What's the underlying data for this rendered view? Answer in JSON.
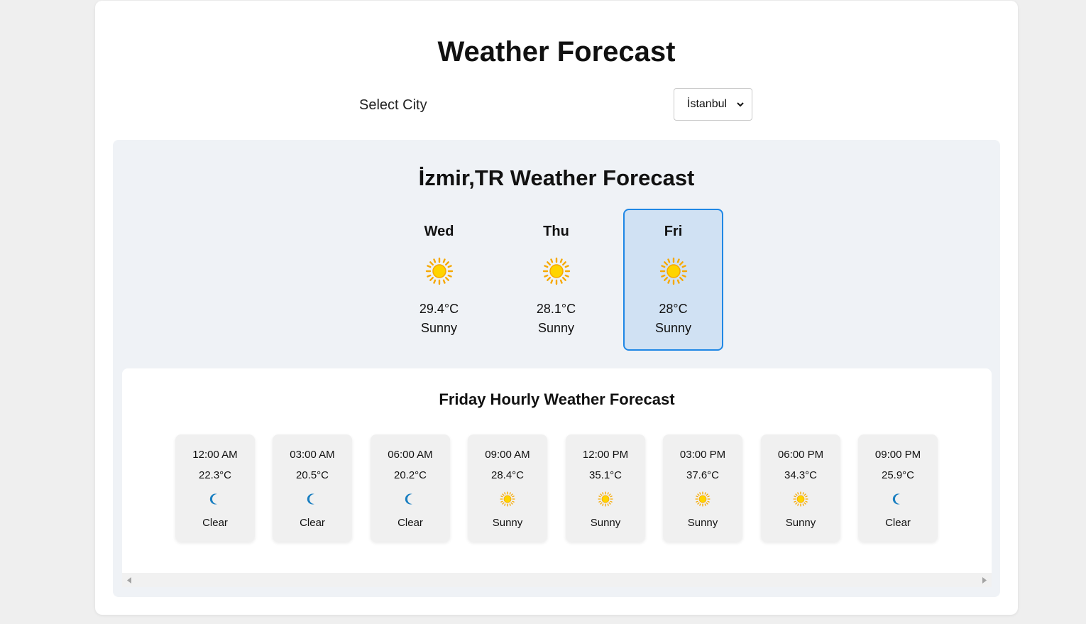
{
  "header": {
    "title": "Weather Forecast"
  },
  "city_picker": {
    "label": "Select City",
    "selected": "İstanbul"
  },
  "forecast": {
    "title": "İzmir,TR Weather Forecast",
    "selected_day": "Fri",
    "days": [
      {
        "name": "Wed",
        "temp": "29.4°C",
        "condition": "Sunny",
        "icon": "sun-icon"
      },
      {
        "name": "Thu",
        "temp": "28.1°C",
        "condition": "Sunny",
        "icon": "sun-icon"
      },
      {
        "name": "Fri",
        "temp": "28°C",
        "condition": "Sunny",
        "icon": "sun-icon"
      }
    ]
  },
  "hourly": {
    "title": "Friday Hourly Weather Forecast",
    "hours": [
      {
        "time": "12:00 AM",
        "temp": "22.3°C",
        "condition": "Clear",
        "icon": "moon-icon"
      },
      {
        "time": "03:00 AM",
        "temp": "20.5°C",
        "condition": "Clear",
        "icon": "moon-icon"
      },
      {
        "time": "06:00 AM",
        "temp": "20.2°C",
        "condition": "Clear",
        "icon": "moon-icon"
      },
      {
        "time": "09:00 AM",
        "temp": "28.4°C",
        "condition": "Sunny",
        "icon": "sun-icon"
      },
      {
        "time": "12:00 PM",
        "temp": "35.1°C",
        "condition": "Sunny",
        "icon": "sun-icon"
      },
      {
        "time": "03:00 PM",
        "temp": "37.6°C",
        "condition": "Sunny",
        "icon": "sun-icon"
      },
      {
        "time": "06:00 PM",
        "temp": "34.3°C",
        "condition": "Sunny",
        "icon": "sun-icon"
      },
      {
        "time": "09:00 PM",
        "temp": "25.9°C",
        "condition": "Clear",
        "icon": "moon-icon"
      }
    ]
  },
  "colors": {
    "selected_border": "#1f87e5",
    "selected_background": "#d0e1f3",
    "sun": "#ffd400",
    "sun_rays": "#f6a800",
    "moon": "#1a7fc1"
  }
}
